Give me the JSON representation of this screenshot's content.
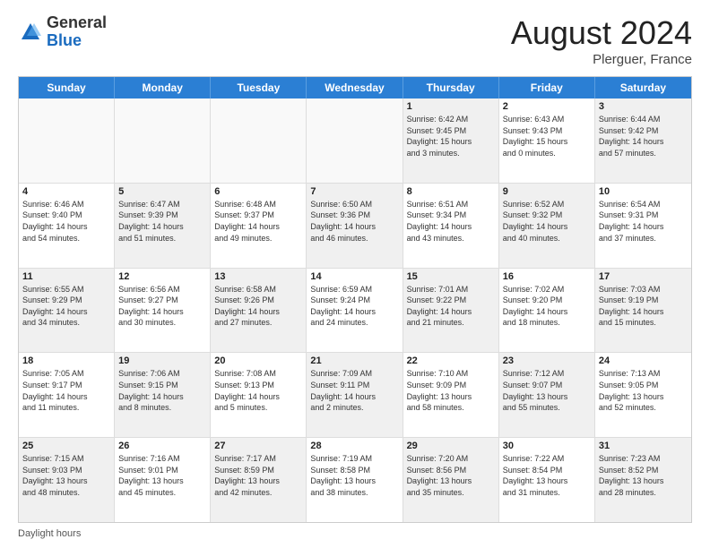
{
  "header": {
    "logo_general": "General",
    "logo_blue": "Blue",
    "month_title": "August 2024",
    "location": "Plerguer, France"
  },
  "footer": {
    "label": "Daylight hours"
  },
  "weekdays": [
    "Sunday",
    "Monday",
    "Tuesday",
    "Wednesday",
    "Thursday",
    "Friday",
    "Saturday"
  ],
  "rows": [
    [
      {
        "day": "",
        "text": "",
        "empty": true
      },
      {
        "day": "",
        "text": "",
        "empty": true
      },
      {
        "day": "",
        "text": "",
        "empty": true
      },
      {
        "day": "",
        "text": "",
        "empty": true
      },
      {
        "day": "1",
        "text": "Sunrise: 6:42 AM\nSunset: 9:45 PM\nDaylight: 15 hours\nand 3 minutes.",
        "shaded": true
      },
      {
        "day": "2",
        "text": "Sunrise: 6:43 AM\nSunset: 9:43 PM\nDaylight: 15 hours\nand 0 minutes.",
        "shaded": false
      },
      {
        "day": "3",
        "text": "Sunrise: 6:44 AM\nSunset: 9:42 PM\nDaylight: 14 hours\nand 57 minutes.",
        "shaded": true
      }
    ],
    [
      {
        "day": "4",
        "text": "Sunrise: 6:46 AM\nSunset: 9:40 PM\nDaylight: 14 hours\nand 54 minutes.",
        "shaded": false
      },
      {
        "day": "5",
        "text": "Sunrise: 6:47 AM\nSunset: 9:39 PM\nDaylight: 14 hours\nand 51 minutes.",
        "shaded": true
      },
      {
        "day": "6",
        "text": "Sunrise: 6:48 AM\nSunset: 9:37 PM\nDaylight: 14 hours\nand 49 minutes.",
        "shaded": false
      },
      {
        "day": "7",
        "text": "Sunrise: 6:50 AM\nSunset: 9:36 PM\nDaylight: 14 hours\nand 46 minutes.",
        "shaded": true
      },
      {
        "day": "8",
        "text": "Sunrise: 6:51 AM\nSunset: 9:34 PM\nDaylight: 14 hours\nand 43 minutes.",
        "shaded": false
      },
      {
        "day": "9",
        "text": "Sunrise: 6:52 AM\nSunset: 9:32 PM\nDaylight: 14 hours\nand 40 minutes.",
        "shaded": true
      },
      {
        "day": "10",
        "text": "Sunrise: 6:54 AM\nSunset: 9:31 PM\nDaylight: 14 hours\nand 37 minutes.",
        "shaded": false
      }
    ],
    [
      {
        "day": "11",
        "text": "Sunrise: 6:55 AM\nSunset: 9:29 PM\nDaylight: 14 hours\nand 34 minutes.",
        "shaded": true
      },
      {
        "day": "12",
        "text": "Sunrise: 6:56 AM\nSunset: 9:27 PM\nDaylight: 14 hours\nand 30 minutes.",
        "shaded": false
      },
      {
        "day": "13",
        "text": "Sunrise: 6:58 AM\nSunset: 9:26 PM\nDaylight: 14 hours\nand 27 minutes.",
        "shaded": true
      },
      {
        "day": "14",
        "text": "Sunrise: 6:59 AM\nSunset: 9:24 PM\nDaylight: 14 hours\nand 24 minutes.",
        "shaded": false
      },
      {
        "day": "15",
        "text": "Sunrise: 7:01 AM\nSunset: 9:22 PM\nDaylight: 14 hours\nand 21 minutes.",
        "shaded": true
      },
      {
        "day": "16",
        "text": "Sunrise: 7:02 AM\nSunset: 9:20 PM\nDaylight: 14 hours\nand 18 minutes.",
        "shaded": false
      },
      {
        "day": "17",
        "text": "Sunrise: 7:03 AM\nSunset: 9:19 PM\nDaylight: 14 hours\nand 15 minutes.",
        "shaded": true
      }
    ],
    [
      {
        "day": "18",
        "text": "Sunrise: 7:05 AM\nSunset: 9:17 PM\nDaylight: 14 hours\nand 11 minutes.",
        "shaded": false
      },
      {
        "day": "19",
        "text": "Sunrise: 7:06 AM\nSunset: 9:15 PM\nDaylight: 14 hours\nand 8 minutes.",
        "shaded": true
      },
      {
        "day": "20",
        "text": "Sunrise: 7:08 AM\nSunset: 9:13 PM\nDaylight: 14 hours\nand 5 minutes.",
        "shaded": false
      },
      {
        "day": "21",
        "text": "Sunrise: 7:09 AM\nSunset: 9:11 PM\nDaylight: 14 hours\nand 2 minutes.",
        "shaded": true
      },
      {
        "day": "22",
        "text": "Sunrise: 7:10 AM\nSunset: 9:09 PM\nDaylight: 13 hours\nand 58 minutes.",
        "shaded": false
      },
      {
        "day": "23",
        "text": "Sunrise: 7:12 AM\nSunset: 9:07 PM\nDaylight: 13 hours\nand 55 minutes.",
        "shaded": true
      },
      {
        "day": "24",
        "text": "Sunrise: 7:13 AM\nSunset: 9:05 PM\nDaylight: 13 hours\nand 52 minutes.",
        "shaded": false
      }
    ],
    [
      {
        "day": "25",
        "text": "Sunrise: 7:15 AM\nSunset: 9:03 PM\nDaylight: 13 hours\nand 48 minutes.",
        "shaded": true
      },
      {
        "day": "26",
        "text": "Sunrise: 7:16 AM\nSunset: 9:01 PM\nDaylight: 13 hours\nand 45 minutes.",
        "shaded": false
      },
      {
        "day": "27",
        "text": "Sunrise: 7:17 AM\nSunset: 8:59 PM\nDaylight: 13 hours\nand 42 minutes.",
        "shaded": true
      },
      {
        "day": "28",
        "text": "Sunrise: 7:19 AM\nSunset: 8:58 PM\nDaylight: 13 hours\nand 38 minutes.",
        "shaded": false
      },
      {
        "day": "29",
        "text": "Sunrise: 7:20 AM\nSunset: 8:56 PM\nDaylight: 13 hours\nand 35 minutes.",
        "shaded": true
      },
      {
        "day": "30",
        "text": "Sunrise: 7:22 AM\nSunset: 8:54 PM\nDaylight: 13 hours\nand 31 minutes.",
        "shaded": false
      },
      {
        "day": "31",
        "text": "Sunrise: 7:23 AM\nSunset: 8:52 PM\nDaylight: 13 hours\nand 28 minutes.",
        "shaded": true
      }
    ]
  ]
}
